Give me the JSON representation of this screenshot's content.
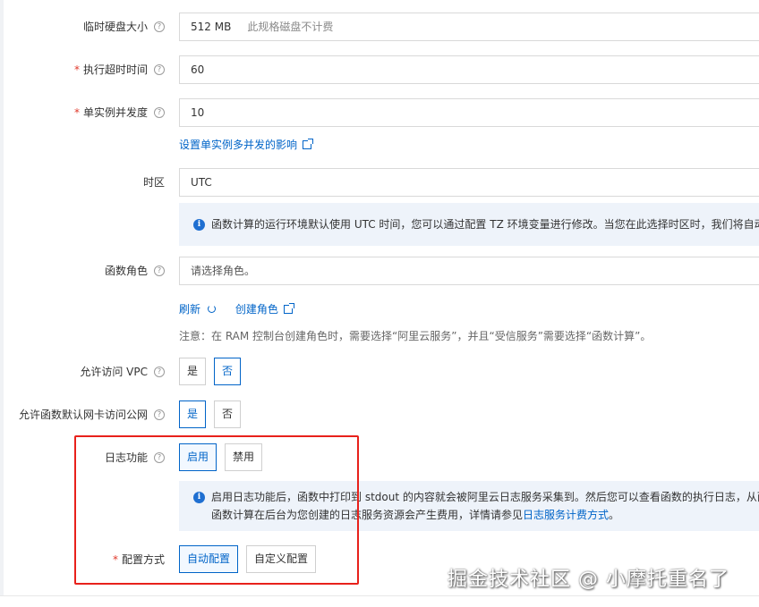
{
  "fields": {
    "temp_disk": {
      "label": "临时硬盘大小",
      "help": "?",
      "value": "512 MB",
      "hint": "此规格磁盘不计费"
    },
    "timeout": {
      "required": "*",
      "label": "执行超时时间",
      "help": "?",
      "value": "60"
    },
    "concurrency": {
      "required": "*",
      "label": "单实例并发度",
      "help": "?",
      "value": "10",
      "link": "设置单实例多并发的影响"
    },
    "timezone": {
      "label": "时区",
      "value": "UTC",
      "notice": "函数计算的运行环境默认使用 UTC 时间，您可以通过配置 TZ 环境变量进行修改。当您在此选择时区时，我们将自动"
    },
    "role": {
      "label": "函数角色",
      "help": "?",
      "placeholder": "请选择角色。",
      "refresh_label": "刷新",
      "create_label": "创建角色",
      "note": "注意：在 RAM 控制台创建角色时，需要选择“阿里云服务”，并且“受信服务”需要选择“函数计算”。"
    },
    "vpc": {
      "label": "允许访问 VPC",
      "help": "?",
      "yes": "是",
      "no": "否",
      "selected": "否"
    },
    "public_net": {
      "label": "允许函数默认网卡访问公网",
      "help": "?",
      "yes": "是",
      "no": "否",
      "selected": "是"
    },
    "logging": {
      "label": "日志功能",
      "help": "?",
      "enable": "启用",
      "disable": "禁用",
      "selected": "启用",
      "notice_line1": "启用日志功能后，函数中打印到 stdout 的内容就会被阿里云日志服务采集到。然后您可以查看函数的执行日志，从而",
      "notice_line2_prefix": "函数计算在后台为您创建的日志服务资源会产生费用，详情请参见",
      "notice_link": "日志服务计费方式",
      "notice_line2_suffix": "。"
    },
    "config_mode": {
      "required": "*",
      "label": "配置方式",
      "auto": "自动配置",
      "custom": "自定义配置",
      "selected": "自动配置"
    }
  },
  "icons": {
    "help": "question-circle-icon",
    "external": "external-link-icon",
    "refresh": "refresh-icon",
    "info": "info-circle-icon"
  },
  "colors": {
    "link": "#0064c8",
    "required": "#e0392b",
    "notice_bg": "#eef3fa",
    "highlight_box": "#e8211b"
  },
  "watermark": "掘金技术社区 @ 小摩托重名了"
}
